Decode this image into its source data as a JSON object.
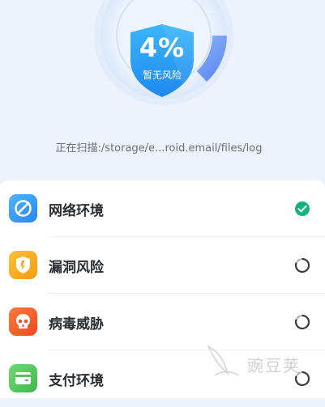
{
  "scanner": {
    "percent": "4%",
    "risk_status": "暂无风险",
    "progress": 0.04,
    "scan_text": "正在扫描:/storage/e...roid.email/files/log",
    "ring_color": "#3d7bf2",
    "shield_color": "#2aa5f7"
  },
  "checks": [
    {
      "label": "网络环境",
      "icon": "network-icon",
      "status": "done",
      "color": "#2b9af3"
    },
    {
      "label": "漏洞风险",
      "icon": "vulnerability-icon",
      "status": "loading",
      "color": "#f5a418"
    },
    {
      "label": "病毒威胁",
      "icon": "virus-icon",
      "status": "loading",
      "color": "#f25a2b"
    },
    {
      "label": "支付环境",
      "icon": "payment-icon",
      "status": "loading",
      "color": "#4cc55c"
    }
  ],
  "watermark": {
    "text": "豌豆荚"
  },
  "colors": {
    "check_green": "#15b37a",
    "spinner": "#3a3c42"
  }
}
